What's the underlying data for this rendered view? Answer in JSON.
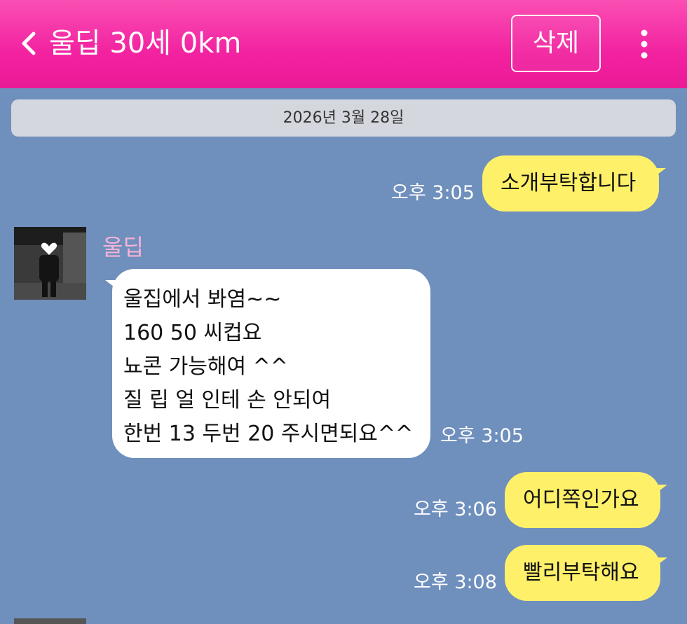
{
  "header": {
    "title": "울딥 30세 0km",
    "delete_label": "삭제"
  },
  "date_divider": "2026년 3월 28일",
  "messages": {
    "m1": {
      "text": "소개부탁합니다",
      "time": "오후 3:05"
    },
    "m2": {
      "sender": "울딥",
      "lines": [
        "울집에서 봐염~~",
        "160 50 씨컵요",
        "뇨콘 가능해여 ^^",
        "질 립 얼 인테 손 안되여",
        "한번 13 두번 20 주시면되요^^"
      ],
      "time": "오후 3:05"
    },
    "m3": {
      "text": "어디쪽인가요",
      "time": "오후 3:06"
    },
    "m4": {
      "text": "빨리부탁해요",
      "time": "오후 3:08"
    }
  },
  "colors": {
    "header": "#f222a0",
    "background": "#6f8fbd",
    "outgoing_bubble": "#fff06a",
    "incoming_bubble": "#ffffff",
    "sender_name": "#f7b3d7"
  },
  "icons": {
    "back": "chevron-left-icon",
    "more": "more-vertical-icon"
  }
}
